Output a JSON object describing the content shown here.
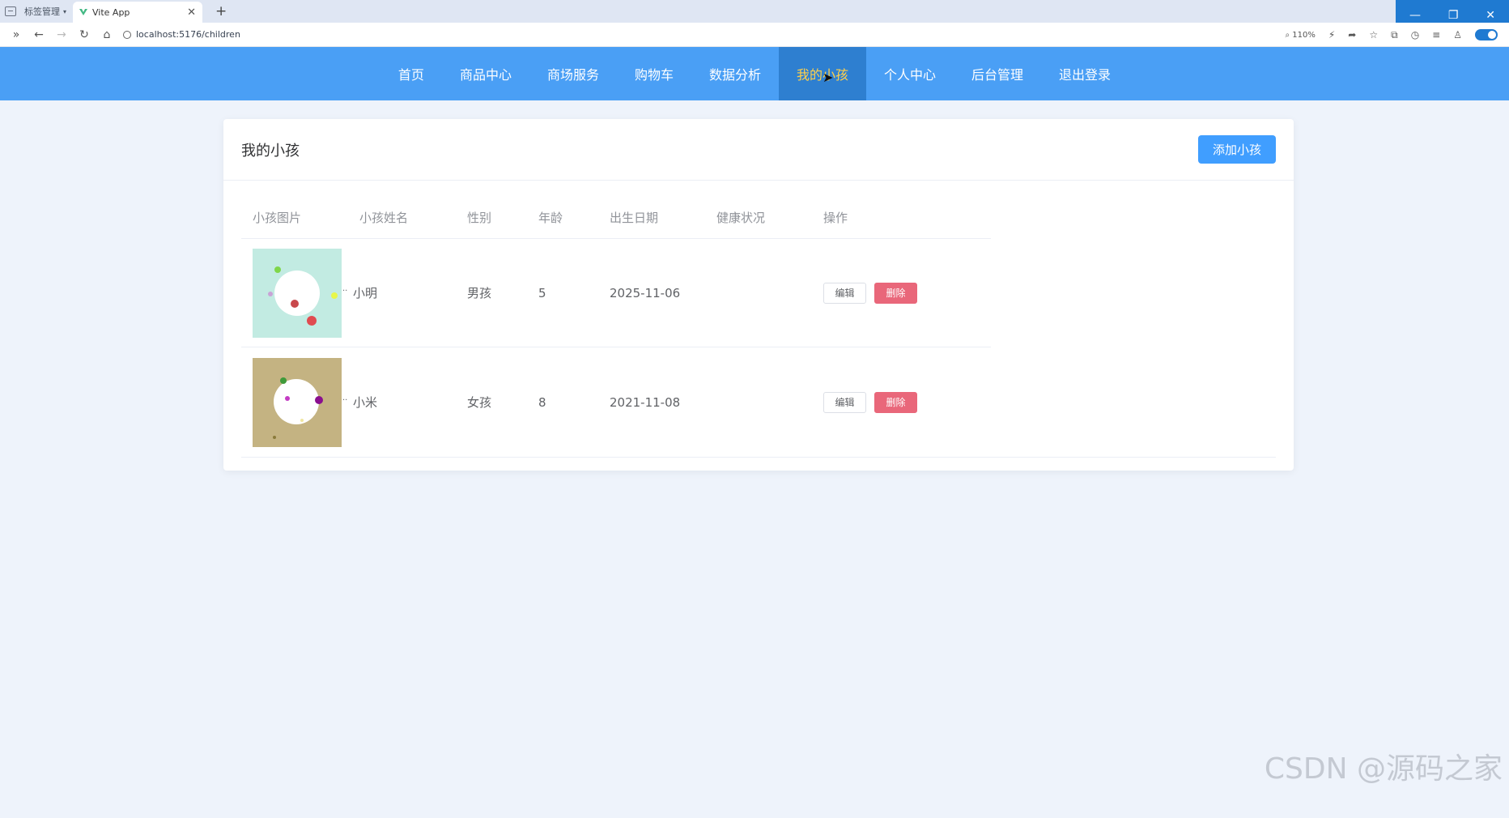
{
  "browser": {
    "tab_group_label": "标签管理",
    "tab_title": "Vite App",
    "url": "localhost:5176/children",
    "zoom": "110%"
  },
  "nav": {
    "items": [
      {
        "label": "首页"
      },
      {
        "label": "商品中心"
      },
      {
        "label": "商场服务"
      },
      {
        "label": "购物车"
      },
      {
        "label": "数据分析"
      },
      {
        "label": "我的小孩"
      },
      {
        "label": "个人中心"
      },
      {
        "label": "后台管理"
      },
      {
        "label": "退出登录"
      }
    ],
    "active_index": 5,
    "active_color": "#ffd04b",
    "bar_color": "#4a9ff5"
  },
  "card": {
    "title": "我的小孩",
    "add_button": "添加小孩"
  },
  "table": {
    "headers": [
      "小孩图片",
      "小孩姓名",
      "性别",
      "年龄",
      "出生日期",
      "健康状况",
      "操作"
    ],
    "rows": [
      {
        "name": "小明",
        "gender": "男孩",
        "age": "5",
        "birth": "2025-11-06",
        "health": "",
        "ellipsis": "..",
        "edit": "编辑",
        "delete": "删除"
      },
      {
        "name": "小米",
        "gender": "女孩",
        "age": "8",
        "birth": "2021-11-08",
        "health": "",
        "ellipsis": "..",
        "edit": "编辑",
        "delete": "删除"
      }
    ]
  },
  "watermark": "CSDN @源码之家"
}
